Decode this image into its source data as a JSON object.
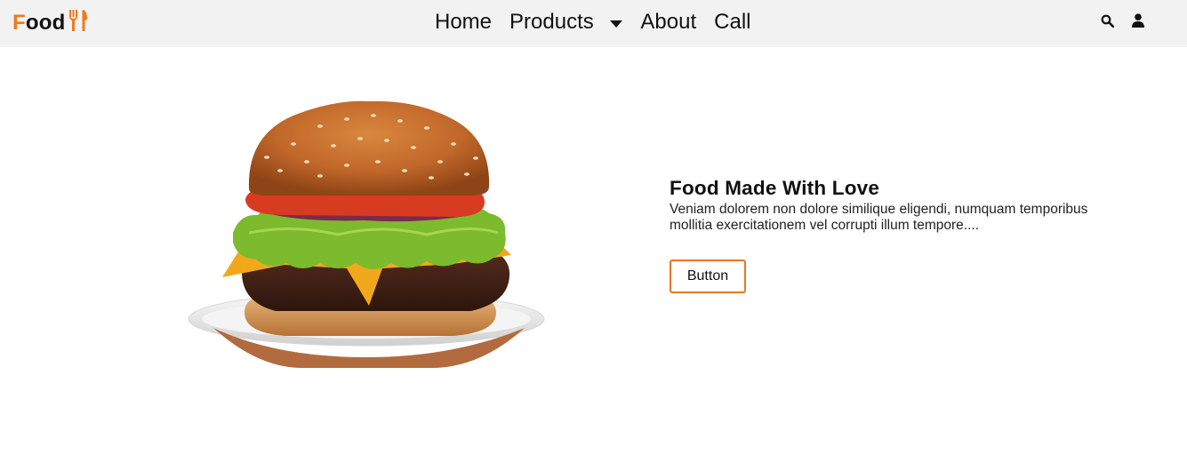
{
  "brand": {
    "first_letter": "F",
    "rest": "ood",
    "icon": "fork-knife-icon",
    "accent_color": "#f07a1a"
  },
  "nav": {
    "items": [
      {
        "label": "Home"
      },
      {
        "label": "Products",
        "icon": "caret-down-icon"
      },
      {
        "label": "About"
      },
      {
        "label": "Call"
      }
    ],
    "icons": [
      "search-icon",
      "user-icon"
    ]
  },
  "hero": {
    "image": "burger-image",
    "title": "Food Made With Love",
    "description": "Veniam dolorem non dolore similique eligendi, numquam temporibus mollitia exercitationem vel corrupti illum tempore....",
    "button_label": "Button",
    "button_border_color": "#e87722"
  }
}
